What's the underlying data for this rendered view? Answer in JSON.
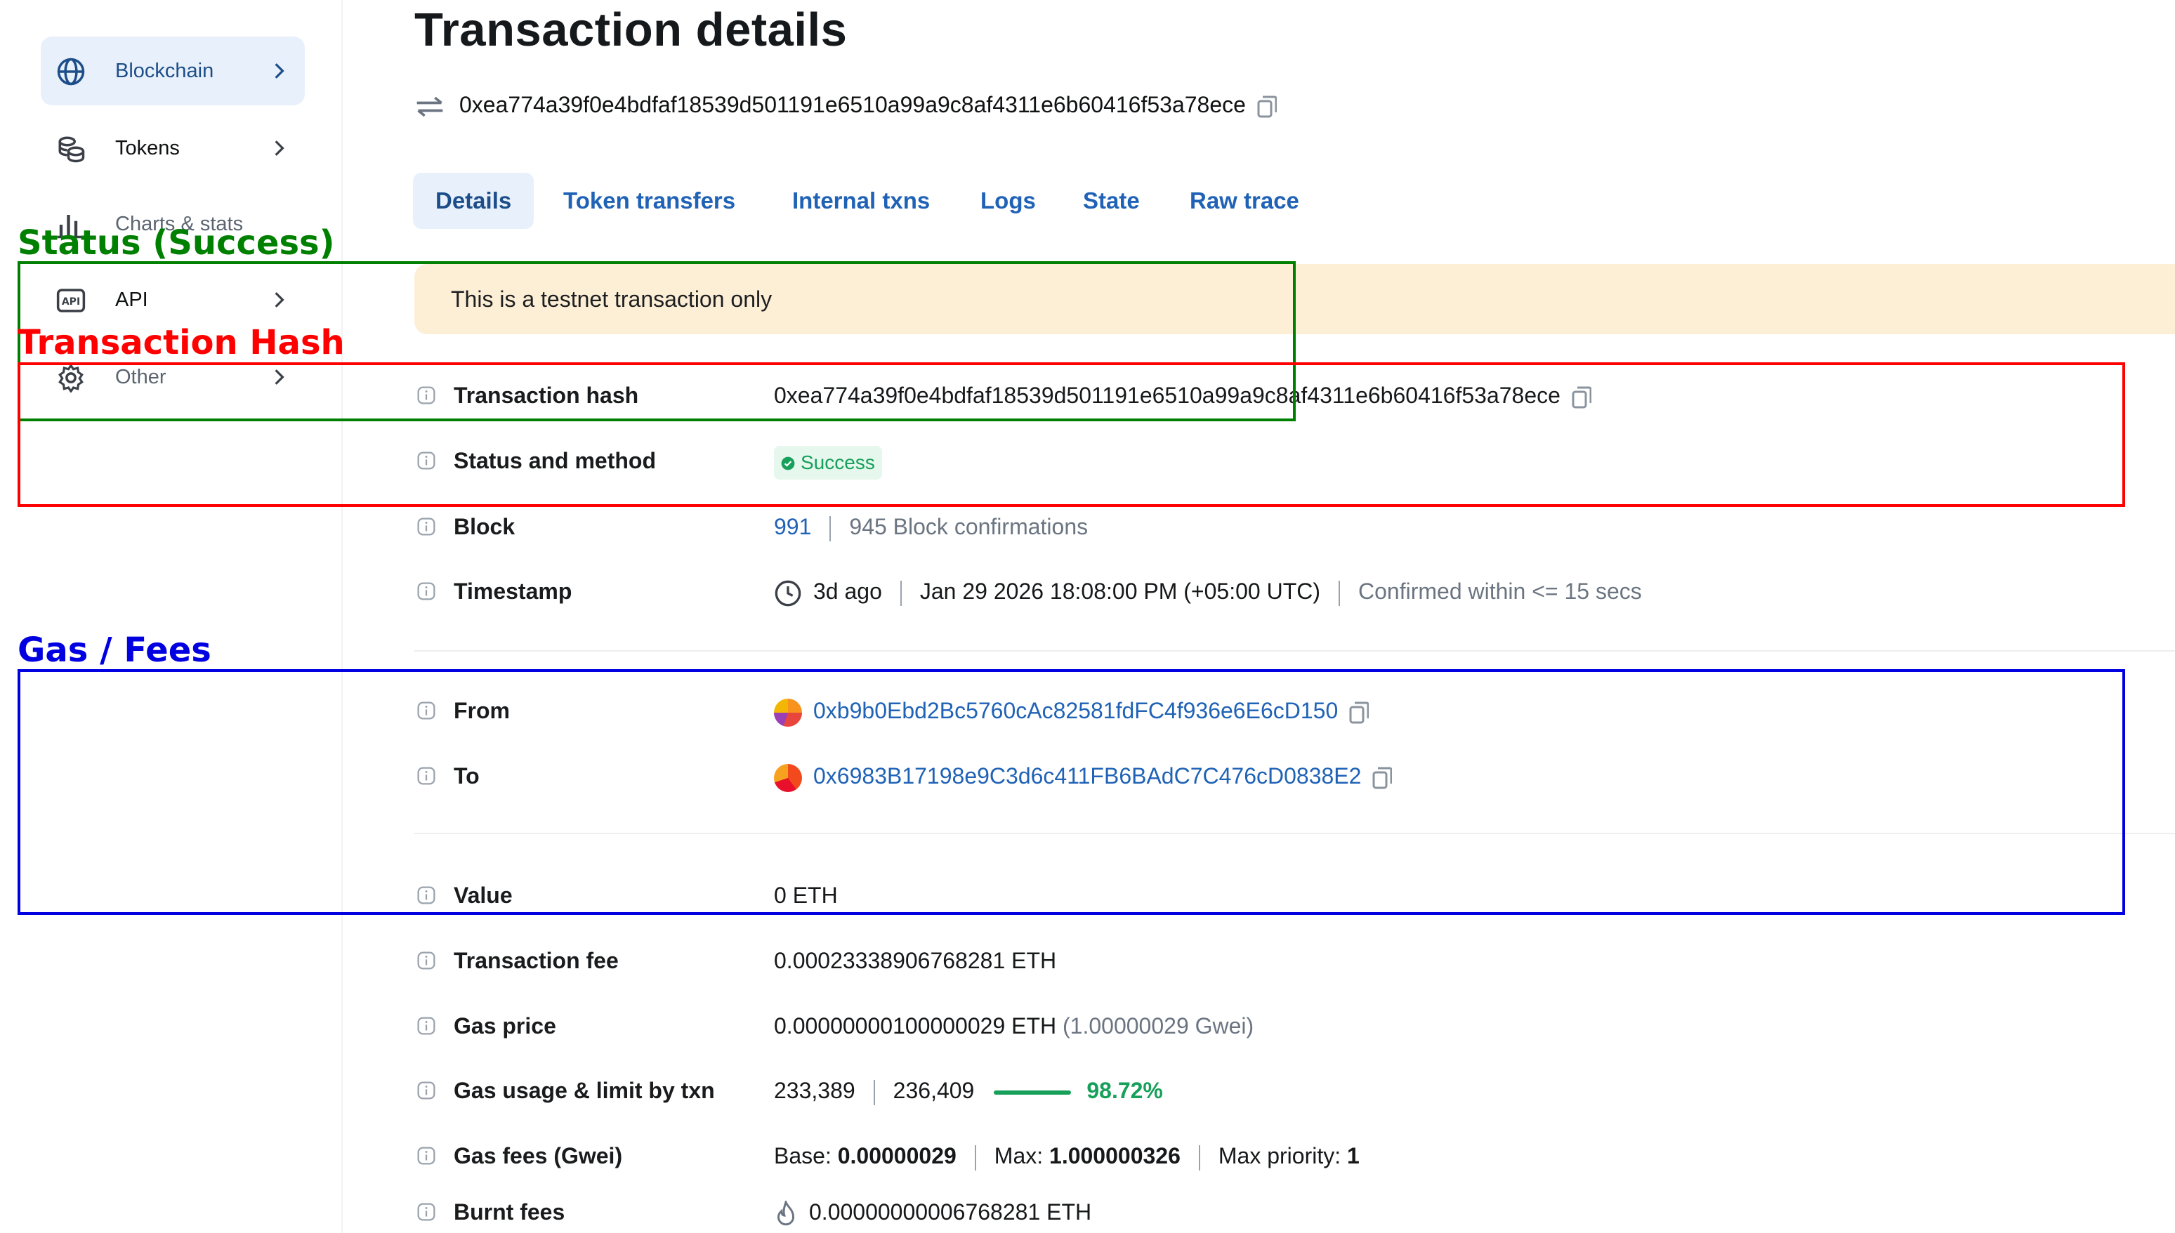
{
  "sidebar": {
    "items": [
      {
        "label": "Blockchain",
        "icon": "globe-icon"
      },
      {
        "label": "Tokens",
        "icon": "tokens-icon"
      },
      {
        "label": "Charts & stats",
        "icon": "chart-icon"
      },
      {
        "label": "API",
        "icon": "api-icon"
      },
      {
        "label": "Other",
        "icon": "gear-icon"
      }
    ]
  },
  "header": {
    "title": "Transaction details",
    "tx_hash": "0xea774a39f0e4bdfaf18539d501191e6510a99a9c8af4311e6b60416f53a78ece"
  },
  "tabs": [
    {
      "label": "Details",
      "active": true
    },
    {
      "label": "Token transfers"
    },
    {
      "label": "Internal txns"
    },
    {
      "label": "Logs"
    },
    {
      "label": "State"
    },
    {
      "label": "Raw trace"
    }
  ],
  "banner": {
    "text": "This is a testnet transaction only"
  },
  "details": {
    "tx_hash": {
      "label": "Transaction hash",
      "value": "0xea774a39f0e4bdfaf18539d501191e6510a99a9c8af4311e6b60416f53a78ece"
    },
    "status": {
      "label": "Status and method",
      "value": "Success"
    },
    "block": {
      "label": "Block",
      "number": "991",
      "confirmations": "945 Block confirmations"
    },
    "timestamp": {
      "label": "Timestamp",
      "relative": "3d ago",
      "absolute": "Jan 29 2026 18:08:00 PM (+05:00 UTC)",
      "confirmed": "Confirmed within <= 15 secs"
    },
    "from": {
      "label": "From",
      "address": "0xb9b0Ebd2Bc5760cAc82581fdFC4f936e6E6cD150"
    },
    "to": {
      "label": "To",
      "address": "0x6983B17198e9C3d6c411FB6BAdC7C476cD0838E2"
    },
    "value": {
      "label": "Value",
      "value": "0 ETH"
    },
    "fee": {
      "label": "Transaction fee",
      "value": "0.00023338906768281 ETH"
    },
    "gas_price": {
      "label": "Gas price",
      "value": "0.00000000100000029 ETH",
      "gwei": "(1.00000029 Gwei)"
    },
    "gas_usage": {
      "label": "Gas usage & limit by txn",
      "used": "233,389",
      "limit": "236,409",
      "percent": "98.72%"
    },
    "gas_fees": {
      "label": "Gas fees (Gwei)",
      "base_label": "Base:",
      "base": "0.00000029",
      "max_label": "Max:",
      "max": "1.000000326",
      "priority_label": "Max priority:",
      "priority": "1"
    },
    "burnt": {
      "label": "Burnt fees",
      "value": "0.00000000006768281 ETH"
    }
  },
  "annotations": {
    "status": {
      "label": "Status (Success)",
      "color": "#008000"
    },
    "hash": {
      "label": "Transaction Hash",
      "color": "#ff0000"
    },
    "gas": {
      "label": "Gas / Fees",
      "color": "#0000e0"
    }
  },
  "colors": {
    "link": "#1f62b6",
    "success": "#16a05a",
    "banner": "#fdefd6",
    "tab_active_bg": "#e8f1fb"
  }
}
